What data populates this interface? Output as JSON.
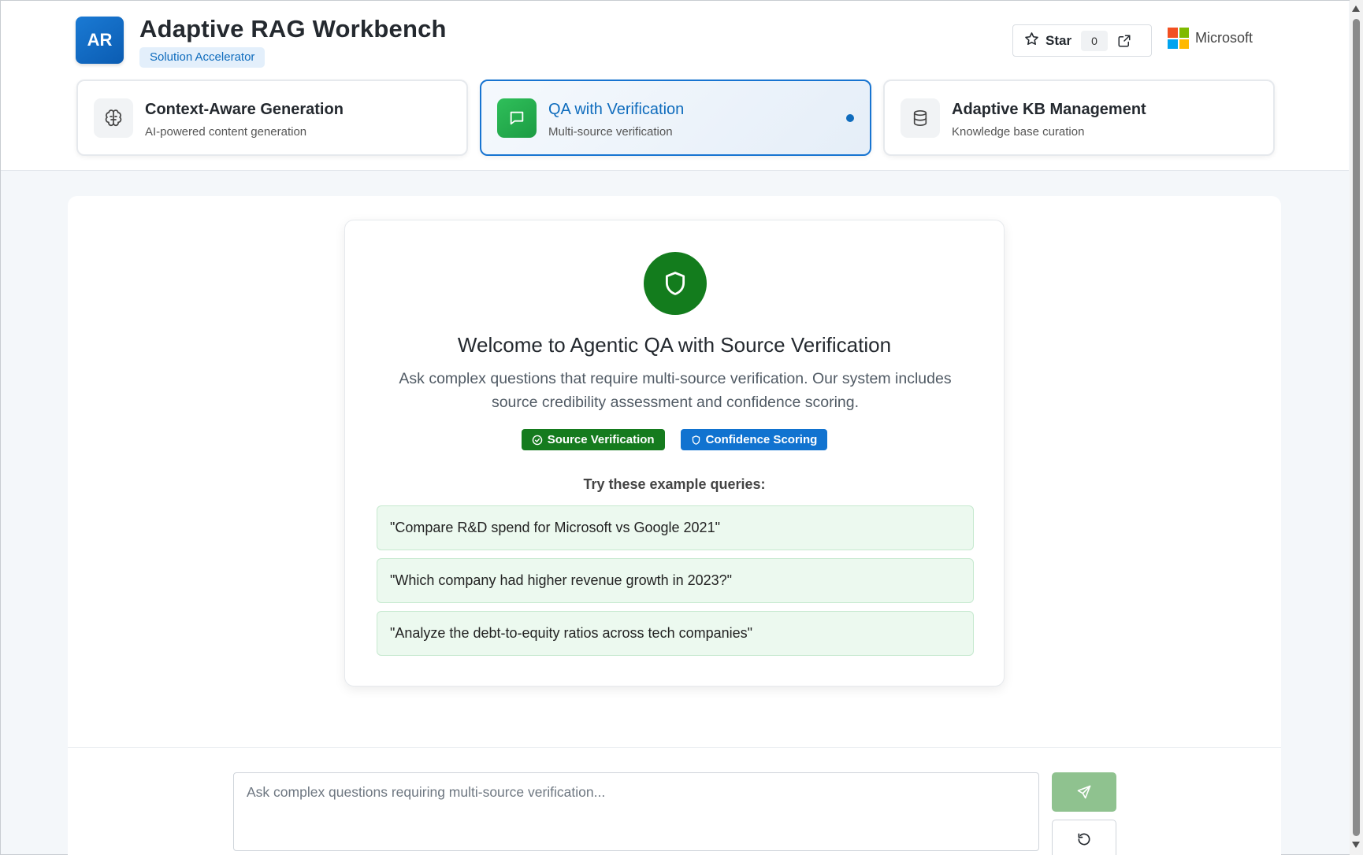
{
  "header": {
    "logo_text": "AR",
    "title": "Adaptive RAG Workbench",
    "badge": "Solution Accelerator",
    "star_label": "Star",
    "star_count": "0",
    "brand_name": "Microsoft"
  },
  "tabs": [
    {
      "title": "Context-Aware Generation",
      "subtitle": "AI-powered content generation",
      "icon": "brain-icon",
      "active": false
    },
    {
      "title": "QA with Verification",
      "subtitle": "Multi-source verification",
      "icon": "chat-icon",
      "active": true
    },
    {
      "title": "Adaptive KB Management",
      "subtitle": "Knowledge base curation",
      "icon": "database-icon",
      "active": false
    }
  ],
  "welcome": {
    "icon": "shield-icon",
    "title": "Welcome to Agentic QA with Source Verification",
    "description": "Ask complex questions that require multi-source verification. Our system includes source credibility assessment and confidence scoring.",
    "pills": [
      "Source Verification",
      "Confidence Scoring"
    ],
    "try_label": "Try these example queries:",
    "queries": [
      "\"Compare R&D spend for Microsoft vs Google 2021\"",
      "\"Which company had higher revenue growth in 2023?\"",
      "\"Analyze the debt-to-equity ratios across tech companies\""
    ]
  },
  "composer": {
    "placeholder": "Ask complex questions requiring multi-source verification...",
    "send_icon": "send-icon",
    "reset_icon": "reset-icon"
  },
  "colors": {
    "accent": "#0f6cbd",
    "success": "#137c1d",
    "query_bg": "#ecf9ef",
    "send_disabled": "#8fc28f"
  }
}
